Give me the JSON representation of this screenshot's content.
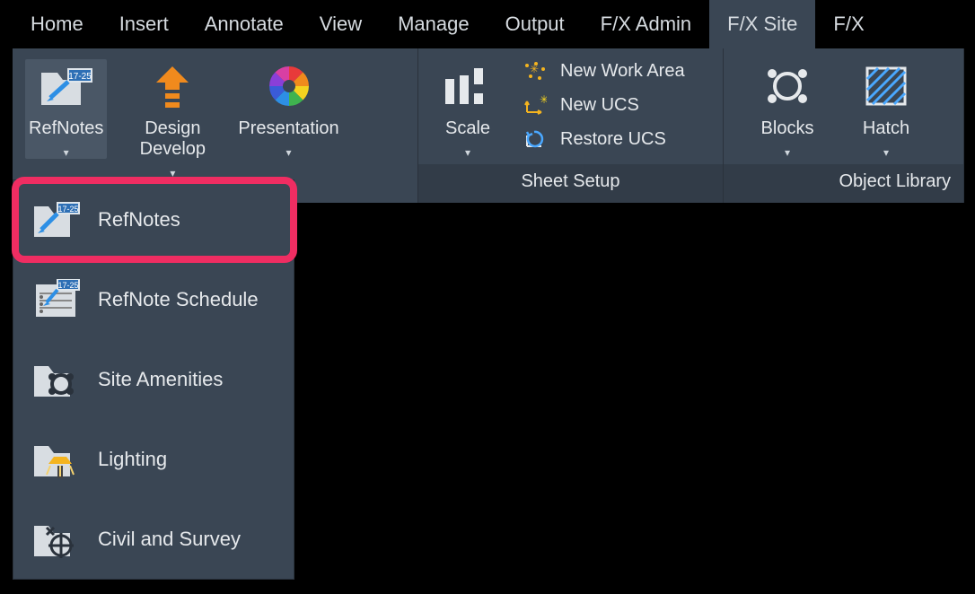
{
  "tabs": [
    {
      "label": "Home"
    },
    {
      "label": "Insert"
    },
    {
      "label": "Annotate"
    },
    {
      "label": "View"
    },
    {
      "label": "Manage"
    },
    {
      "label": "Output"
    },
    {
      "label": "F/X Admin"
    },
    {
      "label": "F/X Site"
    },
    {
      "label": "F/X"
    }
  ],
  "active_tab_index": 7,
  "panel_site": {
    "items": [
      {
        "label": "RefNotes"
      },
      {
        "label": "Design Develop"
      },
      {
        "label": "Presentation"
      }
    ]
  },
  "panel_sheet_setup": {
    "title": "Sheet Setup",
    "scale": {
      "label": "Scale"
    },
    "actions": [
      {
        "label": "New Work Area"
      },
      {
        "label": "New UCS"
      },
      {
        "label": "Restore UCS"
      }
    ]
  },
  "panel_object_library": {
    "title": "Object Library",
    "items": [
      {
        "label": "Blocks"
      },
      {
        "label": "Hatch"
      }
    ]
  },
  "dropdown": {
    "items": [
      {
        "label": "RefNotes"
      },
      {
        "label": "RefNote Schedule"
      },
      {
        "label": "Site  Amenities"
      },
      {
        "label": "Lighting"
      },
      {
        "label": "Civil and Survey"
      }
    ],
    "highlighted_index": 0
  }
}
